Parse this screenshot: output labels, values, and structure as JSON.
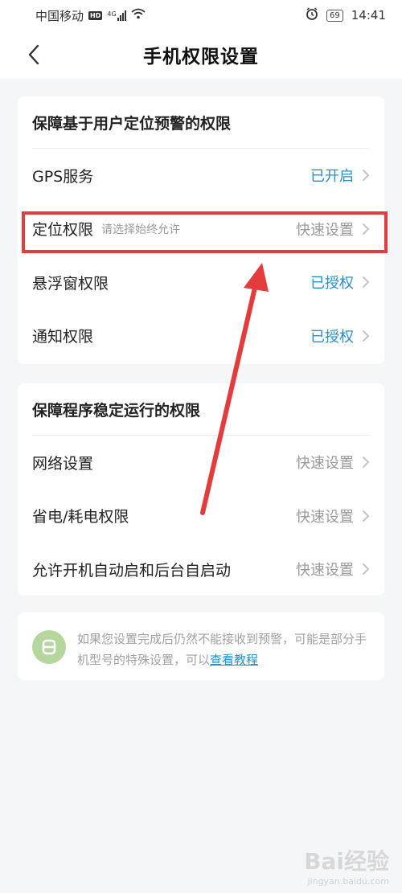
{
  "status_bar": {
    "carrier": "中国移动",
    "hd": "HD",
    "network": "4G",
    "battery": "69",
    "time": "14:41"
  },
  "header": {
    "title": "手机权限设置"
  },
  "section1": {
    "title": "保障基于用户定位预警的权限",
    "rows": [
      {
        "label": "GPS服务",
        "hint": "",
        "status": "已开启"
      },
      {
        "label": "定位权限",
        "hint": "请选择始终允许",
        "status": "快速设置"
      },
      {
        "label": "悬浮窗权限",
        "hint": "",
        "status": "已授权"
      },
      {
        "label": "通知权限",
        "hint": "",
        "status": "已授权"
      }
    ]
  },
  "section2": {
    "title": "保障程序稳定运行的权限",
    "rows": [
      {
        "label": "网络设置",
        "status": "快速设置"
      },
      {
        "label": "省电/耗电权限",
        "status": "快速设置"
      },
      {
        "label": "允许开机自动启和后台自启动",
        "status": "快速设置"
      }
    ]
  },
  "tip": {
    "text": "如果您设置完成后仍然不能接收到预警，可能是部分手机型号的特殊设置，可以",
    "link": "查看教程"
  },
  "watermark": {
    "brand": "Bai经验",
    "url": "jingyan.baidu.com"
  },
  "colors": {
    "accent_blue": "#2a8fc7",
    "annotation_red": "#e23c3c"
  }
}
